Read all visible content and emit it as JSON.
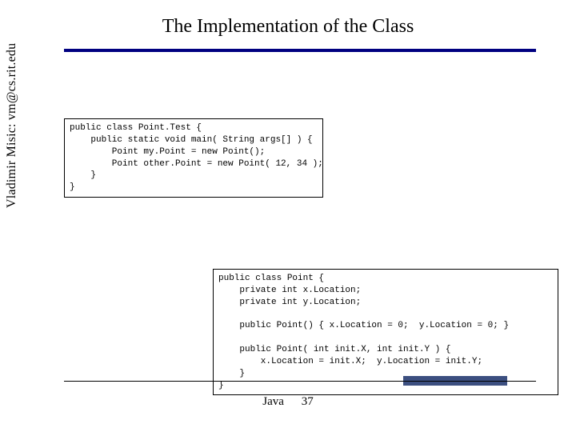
{
  "slide": {
    "title": "The Implementation of the Class",
    "author_sidebar": "Vladimir Misic: vm@cs.rit.edu",
    "footer_label": "Java",
    "footer_page": "37"
  },
  "code": {
    "box1": "public class Point.Test {\n    public static void main( String args[] ) {\n        Point my.Point = new Point();\n        Point other.Point = new Point( 12, 34 );\n    }\n}",
    "box2": "public class Point {\n    private int x.Location;\n    private int y.Location;\n\n    public Point() { x.Location = 0;  y.Location = 0; }\n\n    public Point( int init.X, int init.Y ) {\n        x.Location = init.X;  y.Location = init.Y;\n    }\n}"
  }
}
